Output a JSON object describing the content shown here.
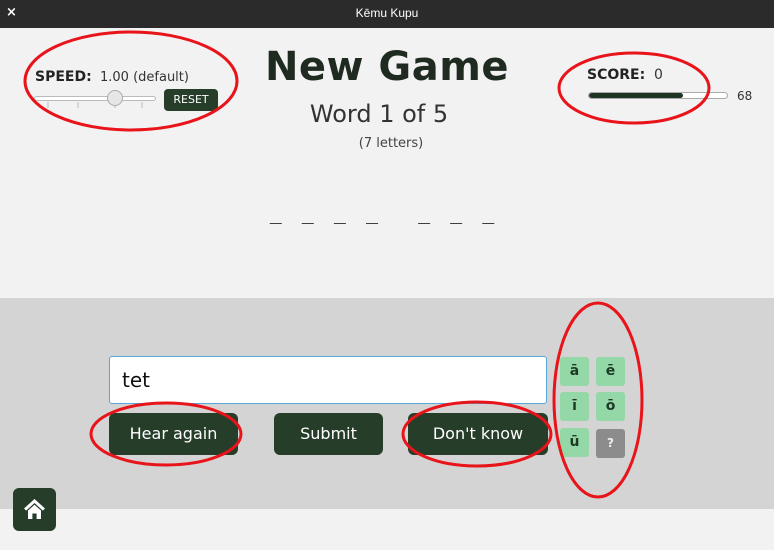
{
  "window": {
    "title": "Kēmu Kupu",
    "close_glyph": "×"
  },
  "speed": {
    "label": "SPEED:",
    "value": "1.00 (default)",
    "reset_label": "RESET",
    "level": 0.63
  },
  "game": {
    "title": "New Game",
    "progress": "Word 1 of 5",
    "letter_count": "(7 letters)",
    "blanks": [
      "_ _ _ _",
      "_ _ _"
    ]
  },
  "score": {
    "label": "SCORE:",
    "value": "0",
    "max": "68",
    "bar_fill_fraction": 0.68
  },
  "input": {
    "value": "tet"
  },
  "buttons": {
    "hear_again": "Hear again",
    "submit": "Submit",
    "dont_know": "Don't know"
  },
  "vowels": [
    "ā",
    "ē",
    "ī",
    "ō",
    "ū"
  ],
  "help_label": "?",
  "icons": {
    "home": "home-icon",
    "close": "close-icon"
  },
  "colors": {
    "button_bg": "#263d2a",
    "vowel_bg": "#95d8a8",
    "annotation": "#e8141a",
    "lower_panel": "#d4d4d4",
    "page_bg": "#f2f2f2"
  }
}
